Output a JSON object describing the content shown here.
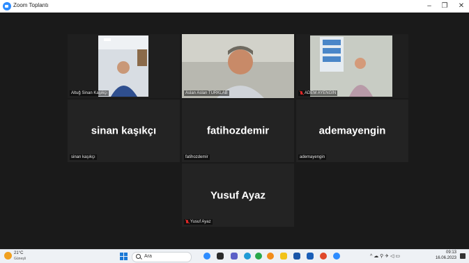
{
  "window": {
    "title": "Zoom Toplantı",
    "minimize": "–",
    "restore": "❐",
    "close": "✕"
  },
  "participants": [
    {
      "display_name": "",
      "label": "Altuğ Sinan Kaşıkçı",
      "muted": false,
      "active_speaker": true,
      "video": true
    },
    {
      "display_name": "",
      "label": "Aslan Aslan TURKLAB",
      "muted": false,
      "active_speaker": false,
      "video": true
    },
    {
      "display_name": "",
      "label": "ADEM AYENGİN",
      "muted": true,
      "active_speaker": false,
      "video": true
    },
    {
      "display_name": "sinan kaşıkçı",
      "label": "sinan kaşıkçı",
      "muted": false,
      "active_speaker": false,
      "video": false
    },
    {
      "display_name": "fatihozdemir",
      "label": "fatihozdemir",
      "muted": false,
      "active_speaker": false,
      "video": false
    },
    {
      "display_name": "ademayengin",
      "label": "ademayengin",
      "muted": false,
      "active_speaker": false,
      "video": false
    },
    {
      "display_name": "Yusuf Ayaz",
      "label": "Yusuf Ayaz",
      "muted": true,
      "active_speaker": false,
      "video": false
    }
  ],
  "taskbar": {
    "weather_temp": "21°C",
    "weather_desc": "Güneşli",
    "search_placeholder": "Ara",
    "tray_icons": "^  ☁  ⚲  ✈  ◁  ▭",
    "time": "09:13",
    "date": "16.06.2023"
  },
  "colors": {
    "active_speaker_border": "#e3e076",
    "tile_bg": "#232323",
    "muted_icon": "#e02828"
  }
}
